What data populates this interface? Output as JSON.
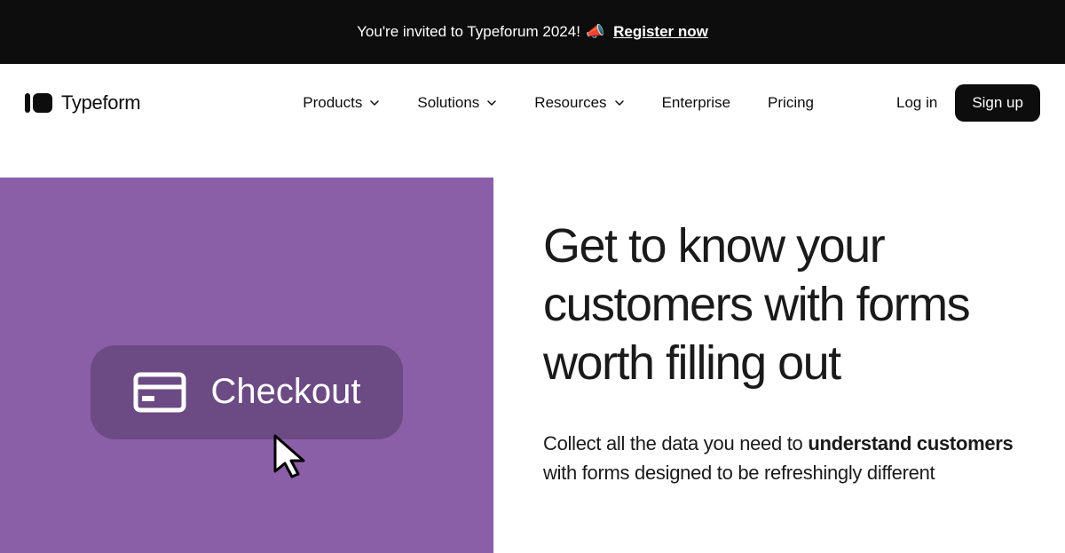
{
  "announcement": {
    "text": "You're invited to Typeforum 2024!",
    "link_text": "Register now"
  },
  "brand": {
    "name": "Typeform"
  },
  "nav": {
    "items": [
      {
        "label": "Products",
        "has_dropdown": true
      },
      {
        "label": "Solutions",
        "has_dropdown": true
      },
      {
        "label": "Resources",
        "has_dropdown": true
      },
      {
        "label": "Enterprise",
        "has_dropdown": false
      },
      {
        "label": "Pricing",
        "has_dropdown": false
      }
    ],
    "login": "Log in",
    "signup": "Sign up"
  },
  "hero": {
    "illustration_button_label": "Checkout",
    "headline": "Get to know your customers with forms worth filling out",
    "subtext_prefix": "Collect all the data you need to ",
    "subtext_bold": "understand customers",
    "subtext_suffix": " with forms designed to be refreshingly different"
  }
}
